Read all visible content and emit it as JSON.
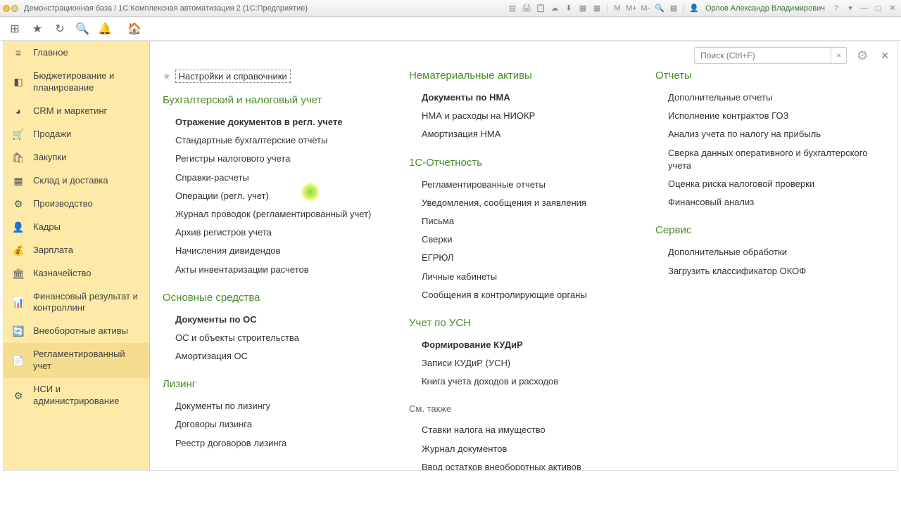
{
  "titlebar": {
    "title": "Демонстрационная база / 1С:Комплексная автоматизация 2  (1С:Предприятие)",
    "user": "Орлов Александр Владимирович",
    "scale": {
      "m": "М",
      "mplus": "М+",
      "mminus": "М-"
    }
  },
  "search": {
    "placeholder": "Поиск (Ctrl+F)"
  },
  "nav": [
    {
      "icon": "≡",
      "label": "Главное"
    },
    {
      "icon": "◧",
      "label": "Бюджетирование и планирование"
    },
    {
      "icon": "◕",
      "label": "CRM и маркетинг"
    },
    {
      "icon": "🛒",
      "label": "Продажи"
    },
    {
      "icon": "🛍",
      "label": "Закупки"
    },
    {
      "icon": "▦",
      "label": "Склад и доставка"
    },
    {
      "icon": "⚙",
      "label": "Производство"
    },
    {
      "icon": "👤",
      "label": "Кадры"
    },
    {
      "icon": "💰",
      "label": "Зарплата"
    },
    {
      "icon": "🏛",
      "label": "Казначейство"
    },
    {
      "icon": "📊",
      "label": "Финансовый результат и контроллинг"
    },
    {
      "icon": "🔄",
      "label": "Внеоборотные активы"
    },
    {
      "icon": "📄",
      "label": "Регламентированный учет"
    },
    {
      "icon": "⚙",
      "label": "НСИ и администрирование"
    }
  ],
  "favorite": "Настройки и справочники",
  "col1": [
    {
      "title": "Бухгалтерский и налоговый учет",
      "items": [
        {
          "t": "Отражение документов в регл. учете",
          "b": true
        },
        {
          "t": "Стандартные бухгалтерские отчеты"
        },
        {
          "t": "Регистры налогового учета"
        },
        {
          "t": "Справки-расчеты"
        },
        {
          "t": "Операции (регл. учет)"
        },
        {
          "t": "Журнал проводок (регламентированный учет)"
        },
        {
          "t": "Архив регистров учета"
        },
        {
          "t": "Начисления дивидендов"
        },
        {
          "t": "Акты инвентаризации расчетов"
        }
      ]
    },
    {
      "title": "Основные средства",
      "items": [
        {
          "t": "Документы по ОС",
          "b": true
        },
        {
          "t": "ОС и объекты строительства"
        },
        {
          "t": "Амортизация ОС"
        }
      ]
    },
    {
      "title": "Лизинг",
      "items": [
        {
          "t": "Документы по лизингу"
        },
        {
          "t": "Договоры лизинга"
        },
        {
          "t": "Реестр договоров лизинга"
        }
      ]
    }
  ],
  "col2": [
    {
      "title": "Нематериальные активы",
      "items": [
        {
          "t": "Документы по НМА",
          "b": true
        },
        {
          "t": "НМА и расходы на НИОКР"
        },
        {
          "t": "Амортизация НМА"
        }
      ]
    },
    {
      "title": "1С-Отчетность",
      "items": [
        {
          "t": "Регламентированные отчеты"
        },
        {
          "t": "Уведомления, сообщения и заявления"
        },
        {
          "t": "Письма"
        },
        {
          "t": "Сверки"
        },
        {
          "t": "ЕГРЮЛ"
        },
        {
          "t": "Личные кабинеты"
        },
        {
          "t": "Сообщения в контролирующие органы"
        }
      ]
    },
    {
      "title": "Учет по УСН",
      "items": [
        {
          "t": "Формирование КУДиР",
          "b": true
        },
        {
          "t": "Записи КУДиР (УСН)"
        },
        {
          "t": "Книга учета доходов и расходов"
        }
      ]
    },
    {
      "title": "См. также",
      "plain": true,
      "items": [
        {
          "t": "Ставки налога на имущество"
        },
        {
          "t": "Журнал документов"
        },
        {
          "t": "Ввод остатков внеоборотных активов"
        }
      ]
    }
  ],
  "col3": [
    {
      "title": "Отчеты",
      "items": [
        {
          "t": "Дополнительные отчеты"
        },
        {
          "t": "Исполнение контрактов ГОЗ"
        },
        {
          "t": "Анализ учета по налогу на прибыль"
        },
        {
          "t": "Сверка данных оперативного и бухгалтерского учета"
        },
        {
          "t": "Оценка риска налоговой проверки"
        },
        {
          "t": "Финансовый анализ"
        }
      ]
    },
    {
      "title": "Сервис",
      "items": [
        {
          "t": "Дополнительные обработки"
        },
        {
          "t": "Загрузить классификатор ОКОФ"
        }
      ]
    }
  ]
}
